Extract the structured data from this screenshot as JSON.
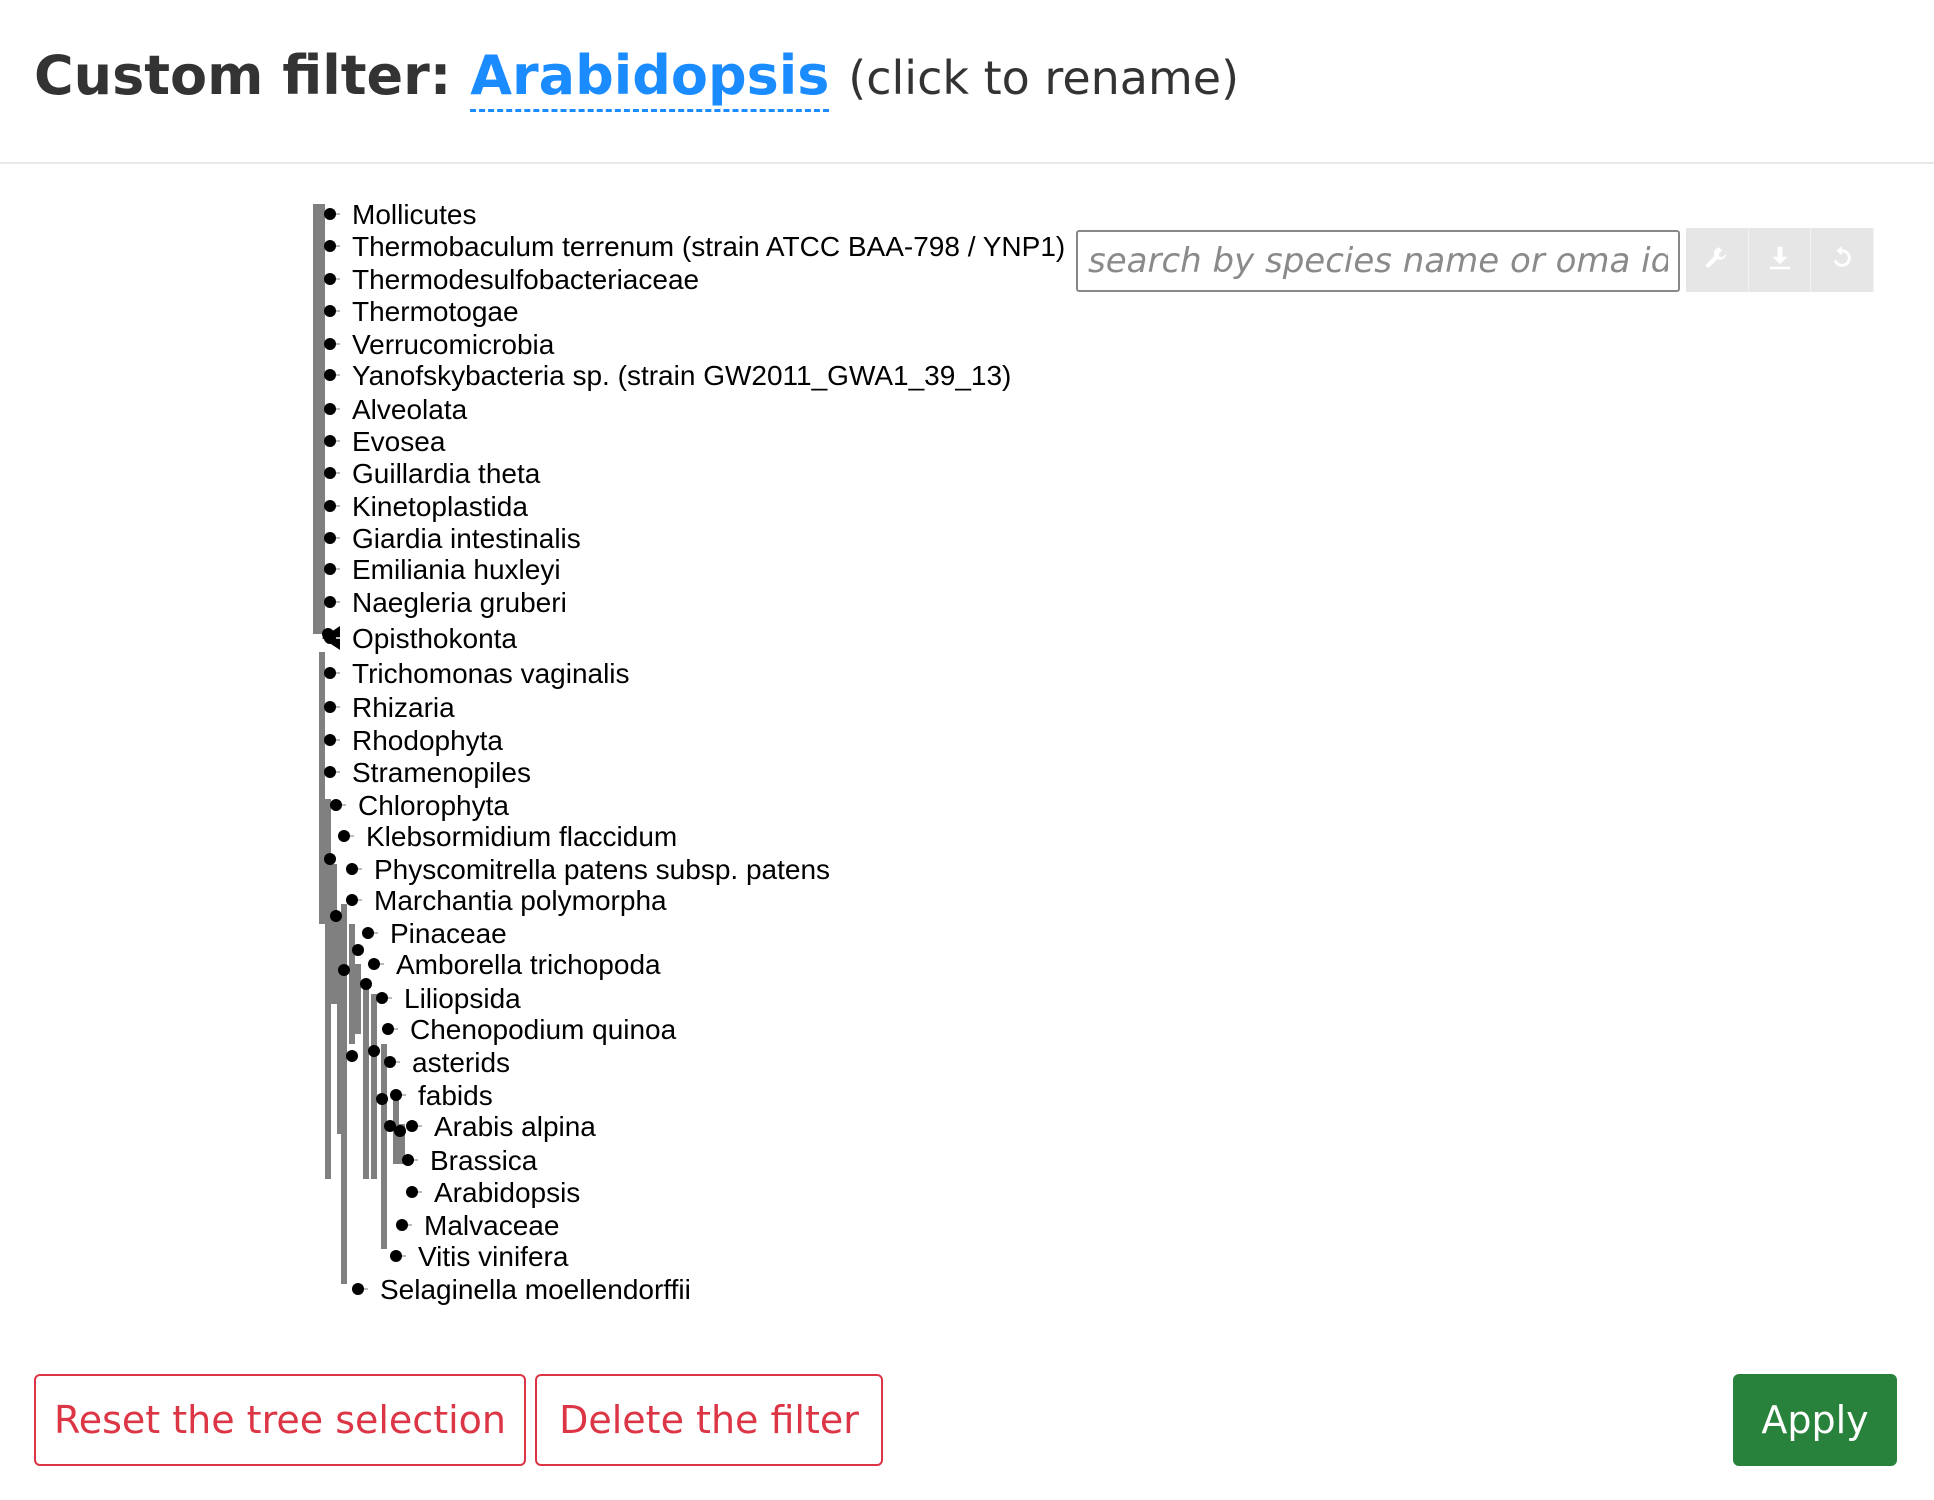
{
  "header": {
    "title_prefix": "Custom filter:",
    "filter_name": "Arabidopsis",
    "rename_hint": "(click to rename)"
  },
  "search": {
    "placeholder": "search by species name or oma id"
  },
  "toolbar": {
    "icons": [
      "wrench-icon",
      "download-icon",
      "reset-icon"
    ]
  },
  "tree": {
    "leaves": [
      "Mollicutes",
      "Thermobaculum terrenum (strain ATCC BAA-798 / YNP1)",
      "Thermodesulfobacteriaceae",
      "Thermotogae",
      "Verrucomicrobia",
      "Yanofskybacteria sp. (strain GW2011_GWA1_39_13)",
      "Alveolata",
      "Evosea",
      "Guillardia theta",
      "Kinetoplastida",
      "Giardia intestinalis",
      "Emiliania huxleyi",
      "Naegleria gruberi",
      "Opisthokonta",
      "Trichomonas vaginalis",
      "Rhizaria",
      "Rhodophyta",
      "Stramenopiles",
      "Chlorophyta",
      "Klebsormidium flaccidum",
      "Physcomitrella patens subsp. patens",
      "Marchantia polymorpha",
      "Pinaceae",
      "Amborella trichopoda",
      "Liliopsida",
      "Chenopodium quinoa",
      "asterids",
      "fabids",
      "Arabis alpina",
      "Brassica",
      "Arabidopsis",
      "Malvaceae",
      "Vitis vinifera",
      "Selaginella moellendorffii"
    ]
  },
  "buttons": {
    "reset": "Reset the tree selection",
    "delete": "Delete the filter",
    "apply": "Apply"
  },
  "colors": {
    "accent": "#1a8cff",
    "danger": "#dc3545",
    "apply": "#28823b",
    "branch": "#808080"
  }
}
